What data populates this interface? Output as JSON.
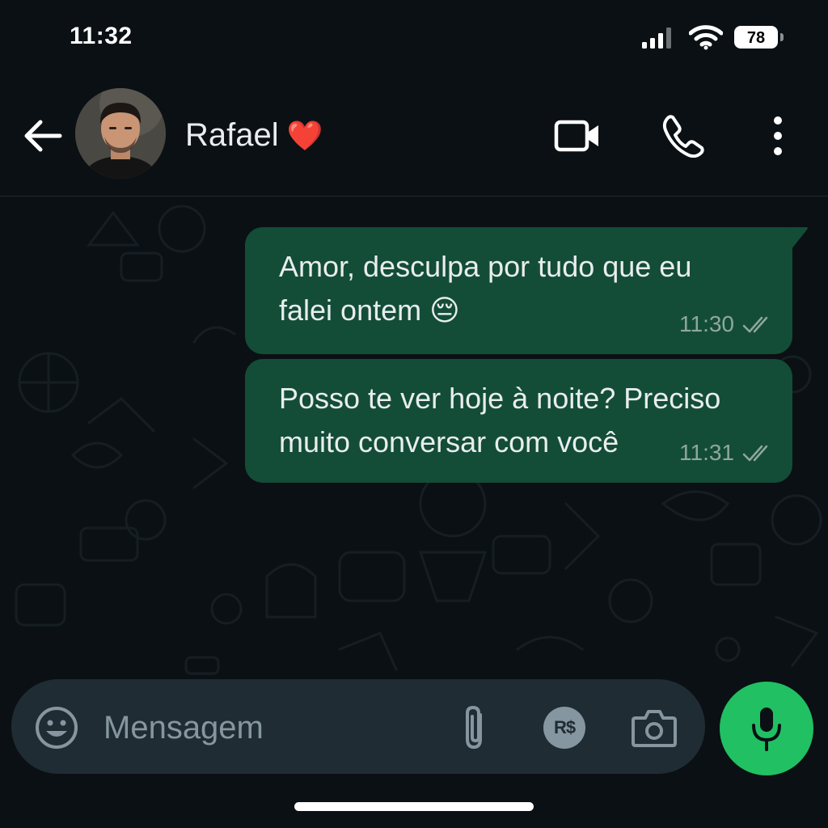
{
  "status_bar": {
    "time": "11:32",
    "battery_level": "78",
    "signal_icon": "cellular-signal-icon",
    "wifi_icon": "wifi-icon"
  },
  "header": {
    "contact_name": "Rafael",
    "contact_emoji": "❤️",
    "back_icon": "arrow-left-icon",
    "video_icon": "video-camera-icon",
    "call_icon": "phone-icon",
    "menu_icon": "more-vertical-icon"
  },
  "messages": [
    {
      "text": "Amor, desculpa por tudo que eu\nfalei ontem 😔",
      "time": "11:30",
      "status": "double-check-icon"
    },
    {
      "text": "Posso te ver hoje à noite? Preciso\nmuito conversar com você",
      "time": "11:31",
      "status": "double-check-icon"
    }
  ],
  "composer": {
    "placeholder": "Mensagem",
    "value": "",
    "pay_label": "R$",
    "emoji_icon": "smiley-icon",
    "attach_icon": "paperclip-icon",
    "camera_icon": "camera-icon",
    "mic_icon": "microphone-icon"
  },
  "colors": {
    "background": "#0b1014",
    "outgoing_bubble": "#134d37",
    "composer": "#1f2c33",
    "mic_button": "#21c063",
    "heart": "#e53935"
  }
}
